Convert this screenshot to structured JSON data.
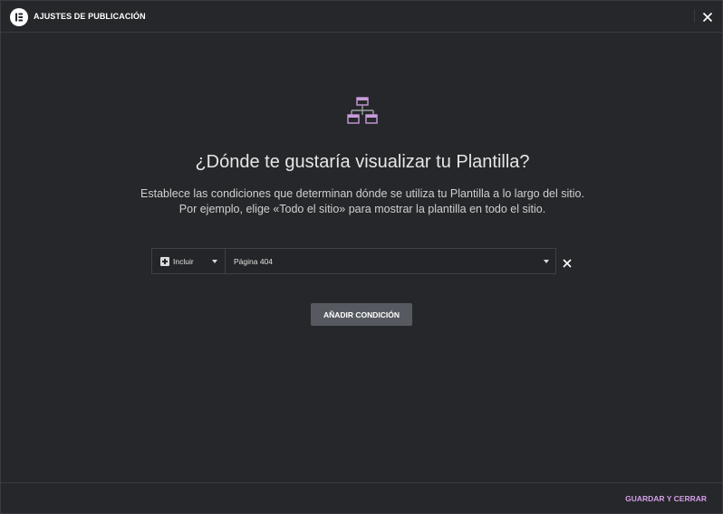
{
  "header": {
    "title": "AJUSTES DE PUBLICACIÓN",
    "logo_icon": "elementor-logo-icon",
    "close_icon": "close-icon"
  },
  "main": {
    "icon": "sitemap-icon",
    "heading": "¿Dónde te gustaría visualizar tu Plantilla?",
    "description_line1": "Establece las condiciones que determinan dónde se utiliza tu Plantilla a lo largo del sitio.",
    "description_line2": "Por ejemplo, elige «Todo el sitio» para mostrar la plantilla en todo el sitio."
  },
  "condition": {
    "include_label": "Incluir",
    "include_icon": "plus-square-icon",
    "target_value": "Página 404",
    "remove_icon": "close-icon"
  },
  "actions": {
    "add_condition_label": "AÑADIR CONDICIÓN",
    "save_close_label": "GUARDAR Y CERRAR"
  },
  "colors": {
    "background": "#26272a",
    "accent": "#d49ee8",
    "icon_accent": "#c89bdc",
    "button": "#565a60"
  }
}
